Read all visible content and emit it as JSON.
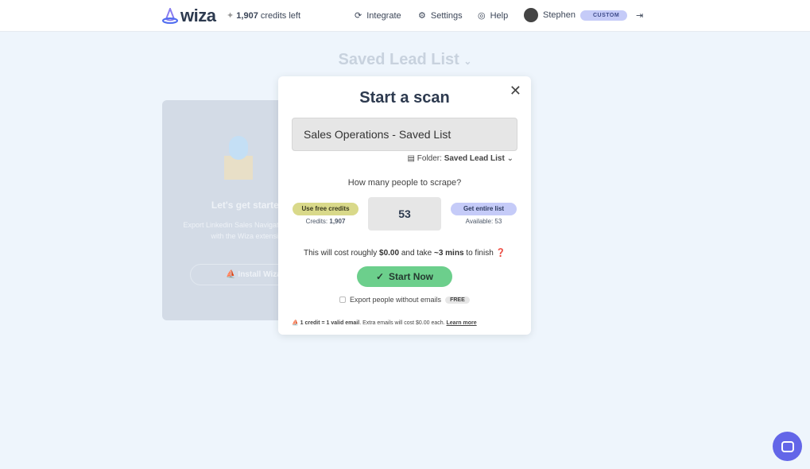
{
  "header": {
    "logo": "wiza",
    "credits_count": "1,907",
    "credits_label": " credits left",
    "nav": [
      "Integrate",
      "Settings",
      "Help"
    ],
    "user": "Stephen",
    "plan_badge": "CUSTOM"
  },
  "page_title": "Saved Lead List",
  "card": {
    "title": "Let's get started!",
    "text": "Export Linkedin Sales Navigator searches with the Wiza extension.",
    "button": "Install Wiza"
  },
  "modal": {
    "title": "Start a scan",
    "list_name": "Sales Operations - Saved List",
    "folder_label": "Folder:",
    "folder_value": "Saved Lead List",
    "question": "How many people to scrape?",
    "free_credits_button": "Use free credits",
    "credits_label": "Credits: ",
    "credits_value": "1,907",
    "count": "53",
    "entire_list_button": "Get entire list",
    "available": "Available: 53",
    "cost_pre": "This will cost roughly ",
    "cost": "$0.00",
    "cost_mid": " and take ",
    "time": "~3 mins",
    "cost_post": " to finish",
    "start_button": "Start Now",
    "export_label": "Export people without emails",
    "free_badge": "FREE",
    "footer_bold": "1 credit = 1 valid email",
    "footer_text": ". Extra emails will cost $0.00 each. ",
    "learn_more": "Learn more"
  },
  "colors": {
    "accent": "#6366e8",
    "start": "#6ccf8c",
    "free": "#d9d98a",
    "entire": "#c5cbf8"
  }
}
